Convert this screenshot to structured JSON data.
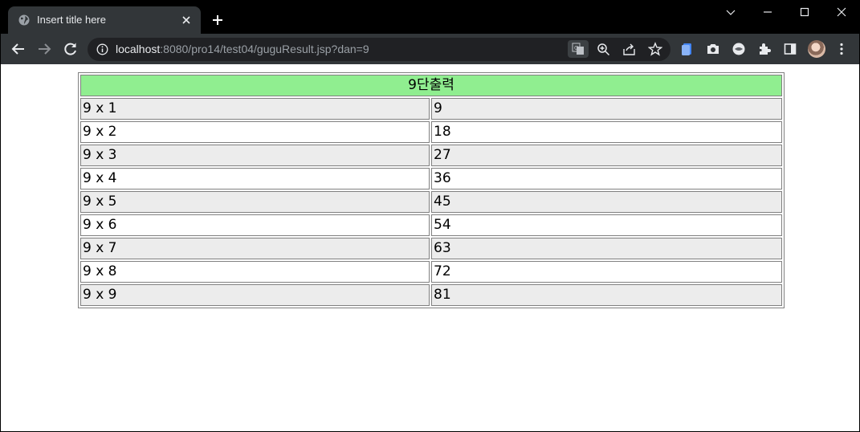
{
  "browser": {
    "tab_title": "Insert title here",
    "url_host": "localhost",
    "url_rest": ":8080/pro14/test04/guguResult.jsp?dan=9",
    "tab_favicon_icon": "globe-icon",
    "colors": {
      "tabstrip": "#000000",
      "toolbar": "#323639",
      "omnibox": "#202124"
    }
  },
  "table": {
    "header": "9단출력",
    "header_color": "#90ee90",
    "row_colors": [
      "#ececec",
      "#ffffff"
    ],
    "rows": [
      {
        "expr": "9 x 1",
        "result": "9"
      },
      {
        "expr": "9 x 2",
        "result": "18"
      },
      {
        "expr": "9 x 3",
        "result": "27"
      },
      {
        "expr": "9 x 4",
        "result": "36"
      },
      {
        "expr": "9 x 5",
        "result": "45"
      },
      {
        "expr": "9 x 6",
        "result": "54"
      },
      {
        "expr": "9 x 7",
        "result": "63"
      },
      {
        "expr": "9 x 8",
        "result": "72"
      },
      {
        "expr": "9 x 9",
        "result": "81"
      }
    ]
  }
}
